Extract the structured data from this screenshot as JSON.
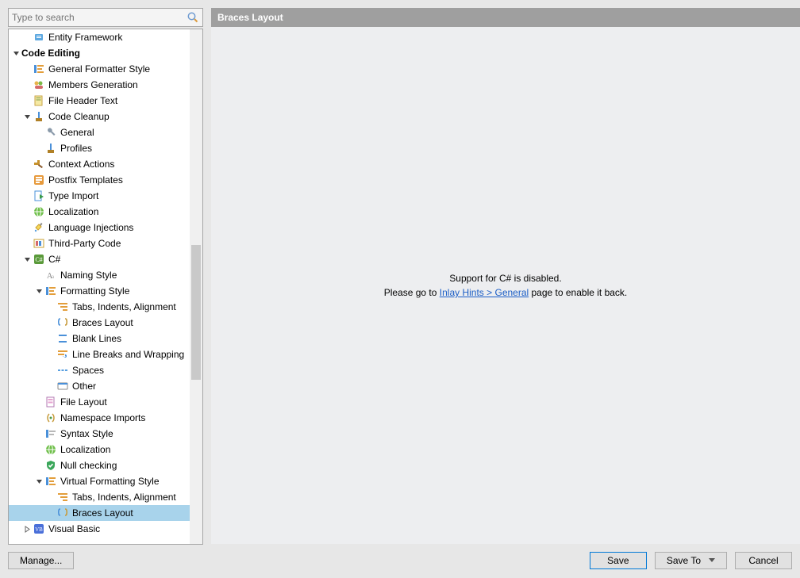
{
  "search": {
    "placeholder": "Type to search"
  },
  "header": {
    "title": "Braces Layout"
  },
  "message": {
    "line1": "Support for C# is disabled.",
    "line2_before": "Please go to ",
    "link": "Inlay Hints > General",
    "line2_after": " page to enable it back."
  },
  "buttons": {
    "manage": "Manage...",
    "save": "Save",
    "save_to": "Save To",
    "cancel": "Cancel"
  },
  "tree": [
    {
      "indent": 30,
      "caret": "",
      "icon": "entity",
      "label": "Entity Framework"
    },
    {
      "indent": 4,
      "caret": "down",
      "icon": "",
      "label": "Code Editing",
      "bold": true
    },
    {
      "indent": 30,
      "caret": "",
      "icon": "formatter",
      "label": "General Formatter Style"
    },
    {
      "indent": 30,
      "caret": "",
      "icon": "members",
      "label": "Members Generation"
    },
    {
      "indent": 30,
      "caret": "",
      "icon": "page",
      "label": "File Header Text"
    },
    {
      "indent": 18,
      "caret": "down",
      "icon": "broom",
      "label": "Code Cleanup"
    },
    {
      "indent": 45,
      "caret": "",
      "icon": "wrench",
      "label": "General"
    },
    {
      "indent": 45,
      "caret": "",
      "icon": "broom",
      "label": "Profiles"
    },
    {
      "indent": 30,
      "caret": "",
      "icon": "hammer",
      "label": "Context Actions"
    },
    {
      "indent": 30,
      "caret": "",
      "icon": "postfix",
      "label": "Postfix Templates"
    },
    {
      "indent": 30,
      "caret": "",
      "icon": "typeimp",
      "label": "Type Import"
    },
    {
      "indent": 30,
      "caret": "",
      "icon": "local",
      "label": "Localization"
    },
    {
      "indent": 30,
      "caret": "",
      "icon": "inject",
      "label": "Language Injections"
    },
    {
      "indent": 30,
      "caret": "",
      "icon": "third",
      "label": "Third-Party Code"
    },
    {
      "indent": 18,
      "caret": "down",
      "icon": "cs",
      "label": "C#"
    },
    {
      "indent": 45,
      "caret": "",
      "icon": "naming",
      "label": "Naming Style"
    },
    {
      "indent": 33,
      "caret": "down",
      "icon": "formatter",
      "label": "Formatting Style"
    },
    {
      "indent": 60,
      "caret": "",
      "icon": "tabs",
      "label": "Tabs, Indents, Alignment"
    },
    {
      "indent": 60,
      "caret": "",
      "icon": "braces",
      "label": "Braces Layout"
    },
    {
      "indent": 60,
      "caret": "",
      "icon": "blank",
      "label": "Blank Lines"
    },
    {
      "indent": 60,
      "caret": "",
      "icon": "wrap",
      "label": "Line Breaks and Wrapping"
    },
    {
      "indent": 60,
      "caret": "",
      "icon": "spaces",
      "label": "Spaces"
    },
    {
      "indent": 60,
      "caret": "",
      "icon": "other",
      "label": "Other"
    },
    {
      "indent": 45,
      "caret": "",
      "icon": "filelay",
      "label": "File Layout"
    },
    {
      "indent": 45,
      "caret": "",
      "icon": "ns",
      "label": "Namespace Imports"
    },
    {
      "indent": 45,
      "caret": "",
      "icon": "syntax",
      "label": "Syntax Style"
    },
    {
      "indent": 45,
      "caret": "",
      "icon": "local",
      "label": "Localization"
    },
    {
      "indent": 45,
      "caret": "",
      "icon": "null",
      "label": "Null checking"
    },
    {
      "indent": 33,
      "caret": "down",
      "icon": "formatter",
      "label": "Virtual Formatting Style"
    },
    {
      "indent": 60,
      "caret": "",
      "icon": "tabs",
      "label": "Tabs, Indents, Alignment"
    },
    {
      "indent": 60,
      "caret": "",
      "icon": "braces",
      "label": "Braces Layout",
      "selected": true
    },
    {
      "indent": 18,
      "caret": "right",
      "icon": "vb",
      "label": "Visual Basic"
    }
  ]
}
